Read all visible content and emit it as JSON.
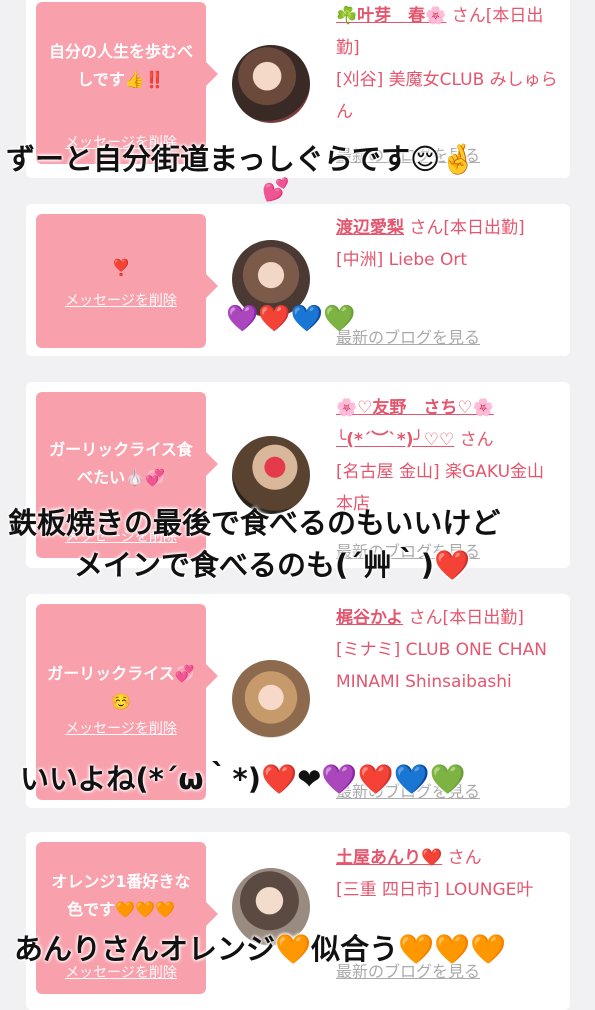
{
  "cards": [
    {
      "message": "自分の人生を歩むべしです👍‼️",
      "delete_label": "メッセージを削除",
      "name": "☘️叶芽　春🌸",
      "san": "さん[本日出勤]",
      "shop": "[刈谷] 美魔女CLUB みしゅらん",
      "blog": "最新のブログを見る"
    },
    {
      "message": "❣️",
      "delete_label": "メッセージを削除",
      "name": "渡辺愛梨",
      "san": "さん[本日出勤]",
      "shop": "[中洲] Liebe Ort",
      "blog": "最新のブログを見る"
    },
    {
      "message": "ガーリックライス食べたい🧄💞",
      "delete_label": "メッセージを削除",
      "name": "🌸♡友野　さち♡🌸",
      "name2": "╰(*´︶`*)╯♡♡",
      "san": "さん",
      "shop": "[名古屋 金山] 楽GAKU金山本店",
      "blog": "最新のブログを見る"
    },
    {
      "message": "ガーリックライス💞☺️",
      "delete_label": "メッセージを削除",
      "name": "梶谷かよ",
      "san": "さん[本日出勤]",
      "shop": "[ミナミ] CLUB ONE CHAN MINAMI Shinsaibashi",
      "blog": "最新のブログを見る"
    },
    {
      "message": "オレンジ1番好きな色です🧡🧡🧡",
      "delete_label": "メッセージを削除",
      "name": "土屋あんり❤️",
      "san": "さん",
      "shop": "[三重 四日市] LOUNGE叶",
      "blog": "最新のブログを見る"
    }
  ],
  "overlays": {
    "line1": "ずーと自分街道まっしぐらです😌🤞",
    "line1_deco": "💕",
    "line2_deco": "💜❤️💙💚",
    "line3a": "鉄板焼きの最後で食べるのもいいけど",
    "line3b": "メインで食べるのも(´艸｀)❤️",
    "line4": "いいよね(*´ω｀*)❤️❤︎💜❤️💙💚",
    "line5": "あんりさんオレンジ🧡似合う🧡🧡🧡"
  },
  "colors": {
    "background": "#f1f1f3",
    "bubble": "#f8a1ad",
    "name_text": "#e4566e",
    "blog_link": "#aaaaaa"
  }
}
